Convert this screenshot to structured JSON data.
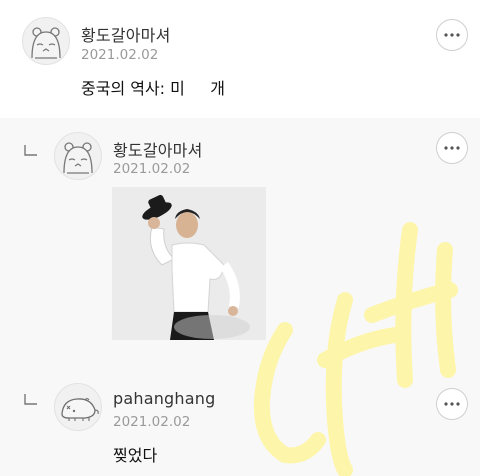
{
  "comments": [
    {
      "author": "황도갈아마셔",
      "date": "2021.02.02",
      "text": "중국의 역사: 미     개",
      "avatar_icon": "sleepy-hamster-avatar-icon"
    },
    {
      "author": "황도갈아마셔",
      "date": "2021.02.02",
      "is_reply": true,
      "attachment": "photo of a man in white shirt and bow tie tipping a black hat",
      "avatar_icon": "sleepy-hamster-avatar-icon"
    },
    {
      "author": "pahanghang",
      "date": "2021.02.02",
      "text": "찢었다",
      "is_reply": true,
      "avatar_icon": "mole-avatar-icon"
    }
  ],
  "icons": {
    "more": "more-options-icon",
    "reply": "reply-arrow-icon"
  },
  "colors": {
    "watermark": "#fff59d",
    "reply_background": "#f8f8f8"
  }
}
